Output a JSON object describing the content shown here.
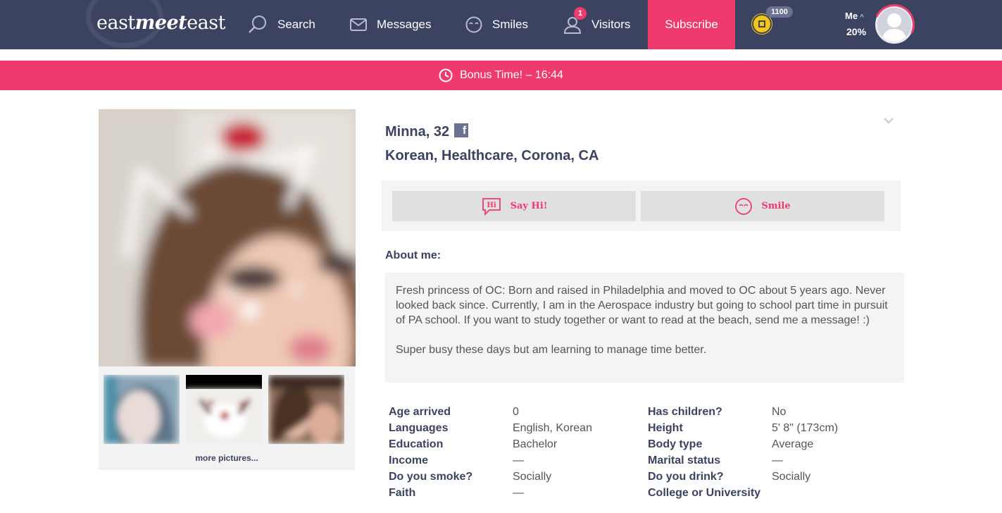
{
  "header": {
    "logo": {
      "part1": "east",
      "part2": "meet",
      "part3": "east"
    },
    "nav": {
      "search": "Search",
      "messages": "Messages",
      "smiles": "Smiles",
      "visitors": "Visitors",
      "visitors_badge": "1"
    },
    "subscribe": "Subscribe",
    "coins": "1100",
    "me": "Me",
    "me_caret": "^",
    "completion": "20%"
  },
  "bonus": {
    "text": "Bonus Time! – 16:44"
  },
  "photos": {
    "more_link": "more pictures..."
  },
  "profile": {
    "name": "Minna, 32",
    "subtitle": "Korean, Healthcare, Corona, CA",
    "facebook_icon_glyph": "f"
  },
  "actions": {
    "say_hi": "Say Hi!",
    "say_hi_icon_text": "Hi",
    "smile": "Smile"
  },
  "about": {
    "title": "About me:",
    "paragraph1": "Fresh princess of OC: Born and raised in Philadelphia and moved to OC about 5 years ago. Never looked back since. Currently, I am in the Aerospace industry but going to school part time in pursuit of PA school. If you want to study together or want to read at the beach, send me a message! :)",
    "paragraph2": "Super busy these days but am learning to manage time better."
  },
  "details_left": [
    {
      "label": "Age arrived",
      "value": "0"
    },
    {
      "label": "Languages",
      "value": "English, Korean"
    },
    {
      "label": "Education",
      "value": "Bachelor"
    },
    {
      "label": "Income",
      "value": "—"
    },
    {
      "label": "Do you smoke?",
      "value": "Socially"
    },
    {
      "label": "Faith",
      "value": "—"
    }
  ],
  "details_right": [
    {
      "label": "Has children?",
      "value": "No"
    },
    {
      "label": "Height",
      "value": "5' 8\" (173cm)"
    },
    {
      "label": "Body type",
      "value": "Average"
    },
    {
      "label": "Marital status",
      "value": "—"
    },
    {
      "label": "Do you drink?",
      "value": "Socially"
    },
    {
      "label": "College or University",
      "value": ""
    }
  ],
  "colors": {
    "nav_bg": "#3c4361",
    "accent": "#ef3a6e",
    "panel": "#f4f4f4",
    "button": "#e0e0e0"
  }
}
